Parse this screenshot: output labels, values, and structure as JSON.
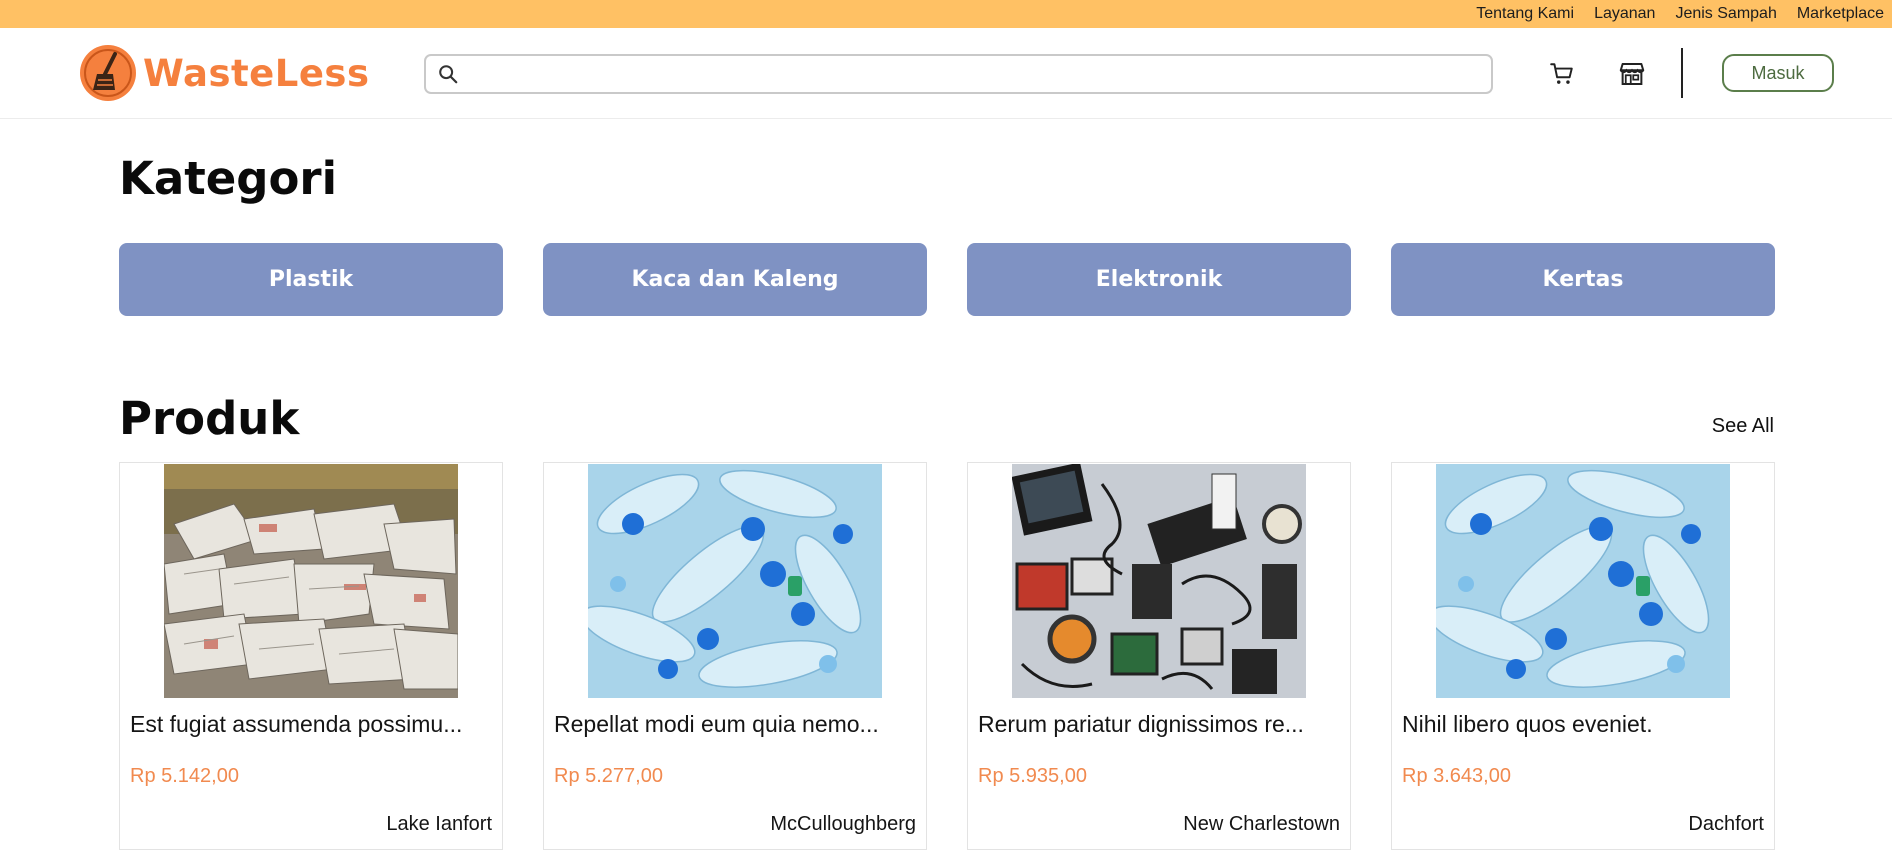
{
  "topnav": {
    "links": [
      "Tentang Kami",
      "Layanan",
      "Jenis Sampah",
      "Marketplace"
    ],
    "background": "#ffc164"
  },
  "header": {
    "brand": "WasteLess",
    "brand_color": "#f5803e",
    "search_value": "",
    "icons": [
      "cart-icon",
      "store-icon",
      "search-icon"
    ],
    "login_label": "Masuk"
  },
  "categories": {
    "title": "Kategori",
    "button_color": "#7f92c3",
    "items": [
      "Plastik",
      "Kaca dan Kaleng",
      "Elektronik",
      "Kertas"
    ]
  },
  "products": {
    "title": "Produk",
    "see_all": "See All",
    "price_color": "#f18a4f",
    "items": [
      {
        "title": "Est fugiat assumenda possimu...",
        "price": "Rp 5.142,00",
        "location": "Lake Ianfort",
        "image": "paper-waste"
      },
      {
        "title": "Repellat modi eum quia nemo...",
        "price": "Rp 5.277,00",
        "location": "McCulloughberg",
        "image": "plastic-bottles"
      },
      {
        "title": "Rerum pariatur dignissimos re...",
        "price": "Rp 5.935,00",
        "location": "New Charlestown",
        "image": "electronic-waste"
      },
      {
        "title": "Nihil libero quos eveniet.",
        "price": "Rp 3.643,00",
        "location": "Dachfort",
        "image": "plastic-bottles"
      }
    ]
  }
}
